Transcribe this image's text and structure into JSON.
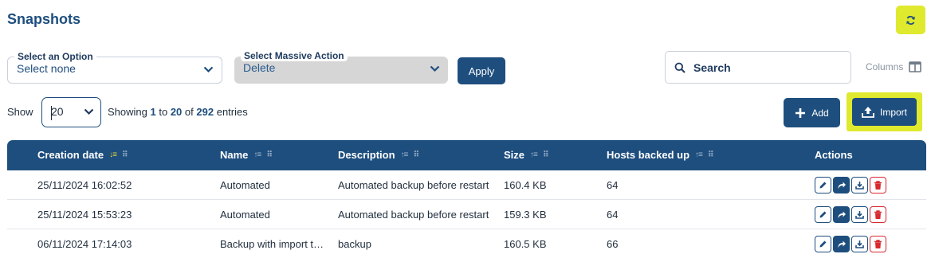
{
  "page": {
    "title": "Snapshots"
  },
  "filters": {
    "option_label": "Select an Option",
    "option_value": "Select none",
    "massive_label": "Select Massive Action",
    "massive_value": "Delete",
    "apply_label": "Apply"
  },
  "search": {
    "label": "Search"
  },
  "columns_label": "Columns",
  "pagination": {
    "show_label": "Show",
    "page_size": "20",
    "showing_prefix": "Showing",
    "from": "1",
    "to_word": "to",
    "to": "20",
    "of_word": "of",
    "total": "292",
    "suffix": "entries"
  },
  "toolbar": {
    "add_label": "Add",
    "import_label": "Import"
  },
  "table": {
    "columns": [
      "Creation date",
      "Name",
      "Description",
      "Size",
      "Hosts backed up",
      "Actions"
    ],
    "rows": [
      [
        "25/11/2024 16:02:52",
        "Automated",
        "Automated backup before restart",
        "160.4 KB",
        "64"
      ],
      [
        "25/11/2024 15:53:23",
        "Automated",
        "Automated backup before restart",
        "159.3 KB",
        "64"
      ],
      [
        "06/11/2024 17:14:03",
        "Backup with import t…",
        "backup",
        "160.5 KB",
        "66"
      ]
    ]
  },
  "colors": {
    "primary": "#1e4e7e",
    "highlight": "#dfe92e",
    "danger": "#d9282f"
  },
  "icons": [
    "refresh-icon",
    "chevron-down-icon",
    "search-icon",
    "columns-icon",
    "plus-icon",
    "upload-icon",
    "sort-icon",
    "drag-handle-icon",
    "edit-icon",
    "restore-icon",
    "download-icon",
    "trash-icon"
  ]
}
